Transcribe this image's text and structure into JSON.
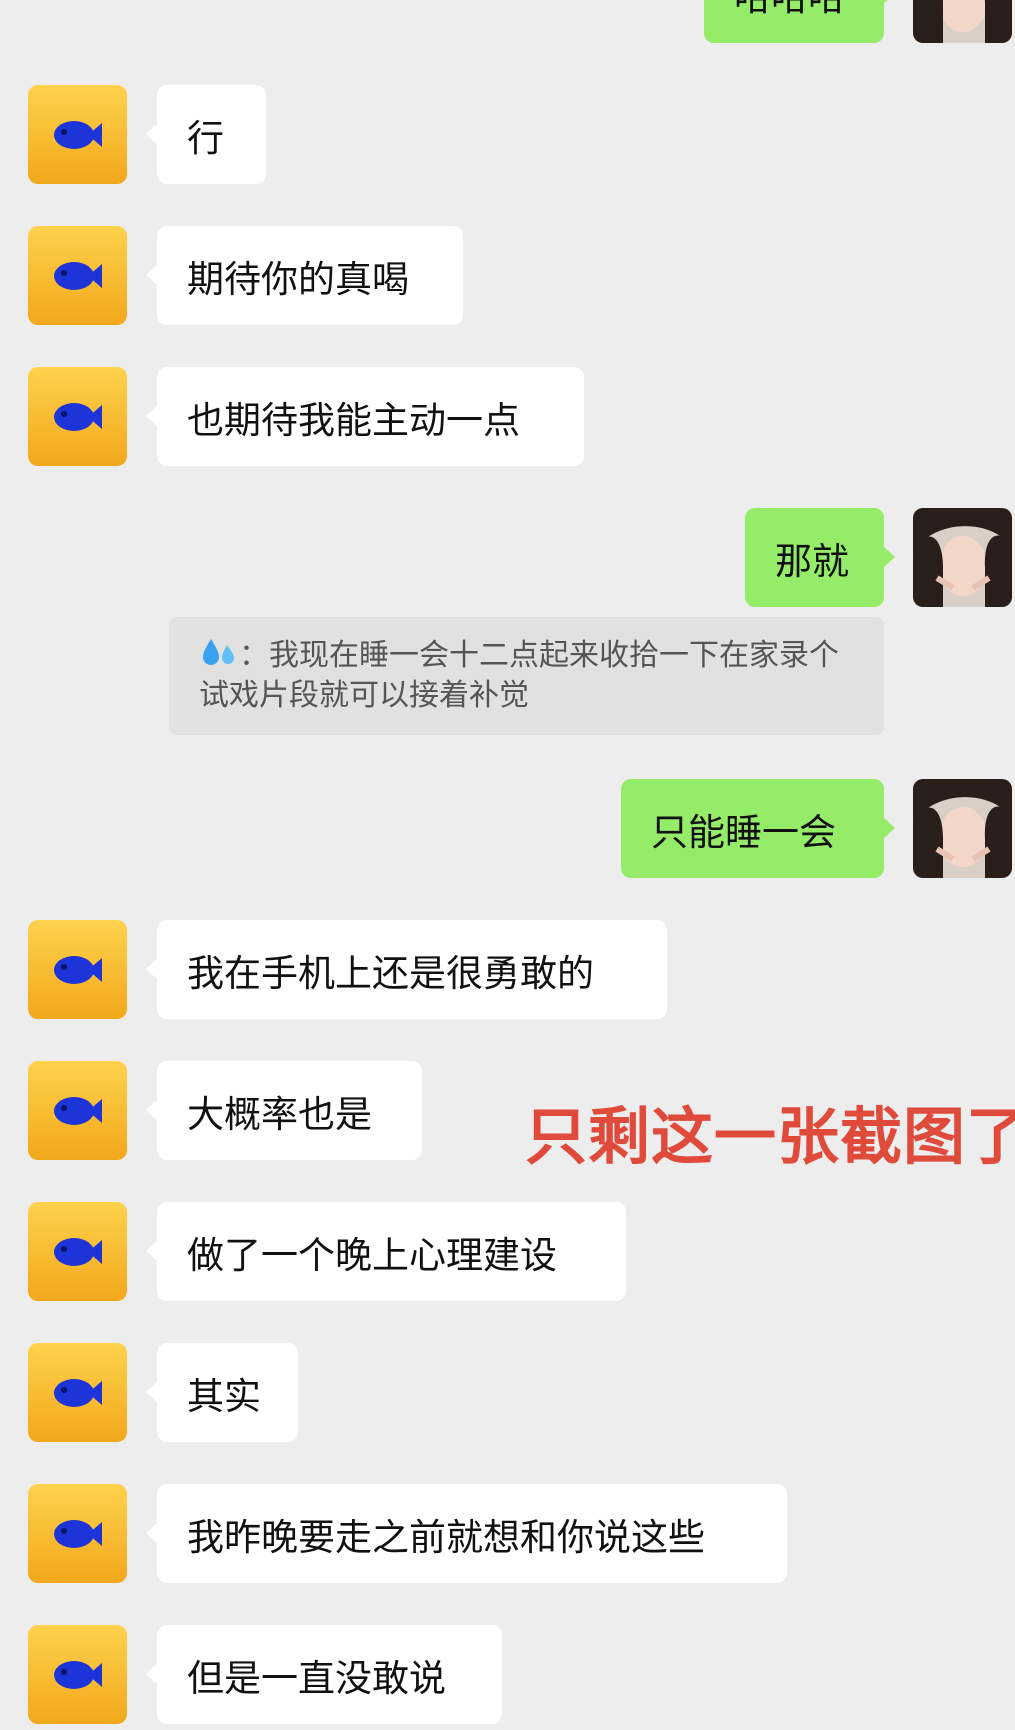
{
  "colors": {
    "background": "#ededed",
    "incoming_bubble": "#ffffff",
    "outgoing_bubble": "#95ec69",
    "quote_bubble": "#e1e1e1",
    "overlay_text": "#e04a3b"
  },
  "icons": {
    "contact_avatar": "blue-fish-on-yellow-avatar-icon",
    "self_avatar": "girl-portrait-avatar-icon",
    "quote_emoji": "sweat-droplets-icon"
  },
  "messages": [
    {
      "side": "out",
      "text": "哈哈哈"
    },
    {
      "side": "in",
      "text": "行"
    },
    {
      "side": "in",
      "text": "期待你的真喝"
    },
    {
      "side": "in",
      "text": "也期待我能主动一点"
    },
    {
      "side": "out",
      "text": "那就"
    },
    {
      "side": "out",
      "text": "只能睡一会"
    },
    {
      "side": "in",
      "text": "我在手机上还是很勇敢的"
    },
    {
      "side": "in",
      "text": "大概率也是"
    },
    {
      "side": "in",
      "text": "做了一个晚上心理建设"
    },
    {
      "side": "in",
      "text": "其实"
    },
    {
      "side": "in",
      "text": "我昨晚要走之前就想和你说这些"
    },
    {
      "side": "in",
      "text": "但是一直没敢说"
    }
  ],
  "quote": {
    "separator": "：",
    "text": "我现在睡一会十二点起来收拾一下在家录个试戏片段就可以接着补觉"
  },
  "overlay_text": "只剩这一张截图了"
}
